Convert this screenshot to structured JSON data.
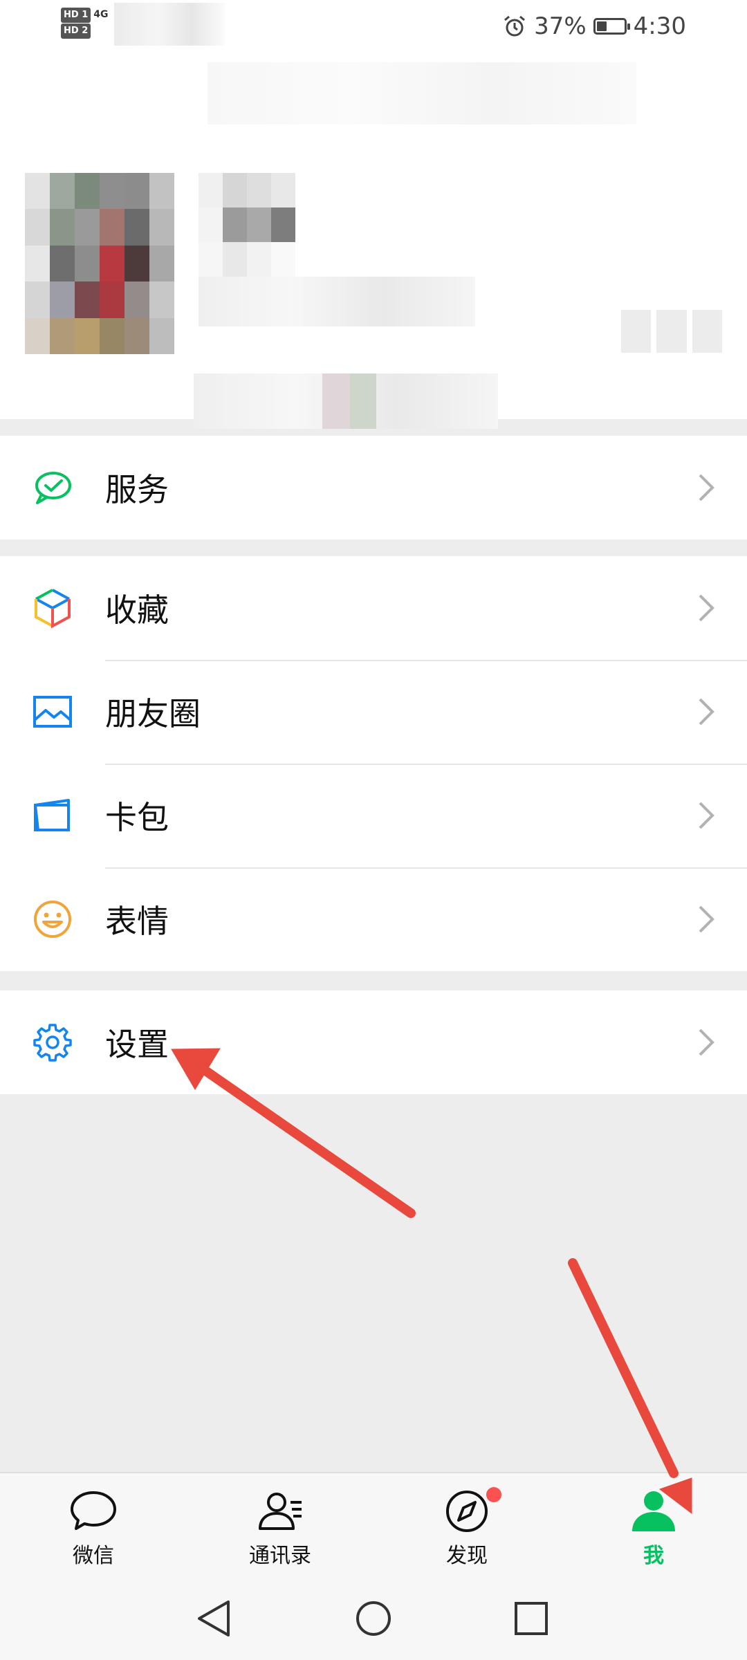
{
  "status_bar": {
    "sim1": "HD 1",
    "sim2": "HD 2",
    "network": "4G",
    "alarm_icon": "alarm-clock-icon",
    "battery": "37%",
    "battery_level": 0.37,
    "time": "4:30"
  },
  "menu": {
    "service": {
      "label": "服务",
      "icon": "wechat-pay-icon",
      "color": "#07c160"
    },
    "favorites": {
      "label": "收藏",
      "icon": "cube-icon"
    },
    "moments": {
      "label": "朋友圈",
      "icon": "picture-icon",
      "color": "#1485ee"
    },
    "cards": {
      "label": "卡包",
      "icon": "card-wallet-icon",
      "color": "#1485ee"
    },
    "stickers": {
      "label": "表情",
      "icon": "smiley-icon",
      "color": "#f0a43a"
    },
    "settings": {
      "label": "设置",
      "icon": "gear-icon",
      "color": "#1485ee"
    }
  },
  "tabbar": {
    "chats": {
      "label": "微信",
      "icon": "chat-bubble-icon"
    },
    "contacts": {
      "label": "通讯录",
      "icon": "contacts-icon"
    },
    "discover": {
      "label": "发现",
      "icon": "compass-icon",
      "badge": "red-dot"
    },
    "me": {
      "label": "我",
      "icon": "person-icon",
      "active": true,
      "color": "#07c160"
    }
  },
  "annotation_color": "#e8493c"
}
